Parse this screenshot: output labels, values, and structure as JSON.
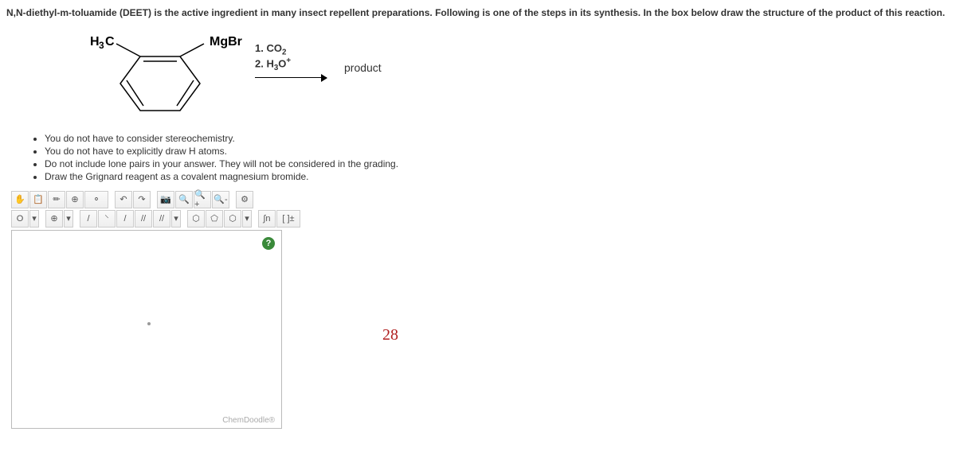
{
  "header": "N,N-diethyl-m-toluamide (DEET) is the active ingredient in many insect repellent preparations. Following is one of the steps in its synthesis. In the box below draw the structure of the product of this reaction.",
  "molecule": {
    "left_label": "H3C",
    "right_label": "MgBr"
  },
  "conditions": {
    "step1": "1. CO2",
    "step2": "2. H3O+"
  },
  "product_label": "product",
  "instructions": [
    "You do not have to consider stereochemistry.",
    "You do not have to explicitly draw H atoms.",
    "Do not include lone pairs in your answer. They will not be considered in the grading.",
    "Draw the Grignard reagent as a covalent magnesium bromide."
  ],
  "toolbar": {
    "row1": [
      "✋",
      "📋",
      "✏",
      "⊕",
      "⚬",
      "↶",
      "↷",
      "📷",
      "🔍",
      "🔍+",
      "🔍-",
      "⚙"
    ],
    "row2": [
      "O",
      "▾",
      "⊕",
      "▾",
      "/",
      "⸌",
      "/",
      "//",
      "//",
      "▾",
      "⬡",
      "⬠",
      "⬡",
      "▾",
      "∫n",
      "[ ]±"
    ]
  },
  "canvas": {
    "help": "?",
    "watermark": "ChemDoodle®"
  },
  "annotation": "28"
}
